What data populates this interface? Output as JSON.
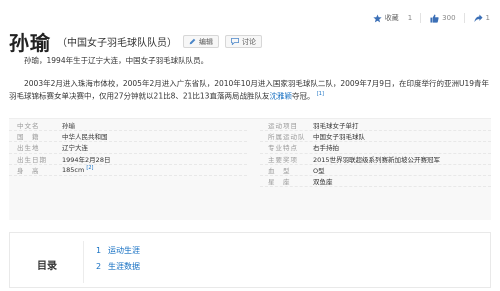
{
  "actions": {
    "favorite_label": "收藏",
    "favorite_count": "1",
    "like_count": "300",
    "share_count": "1"
  },
  "title": {
    "name": "孙瑜",
    "subtitle": "（中国女子羽毛球队队员）",
    "edit_label": "编辑",
    "discuss_label": "讨论"
  },
  "intro": {
    "p1": "孙瑜，1994年生于辽宁大连，中国女子羽毛球队队员。",
    "p2_before": "2003年2月进入珠海市体校，2005年2月进入广东省队，2010年10月进入国家羽毛球队二队，2009年7月9日，在印度举行的亚洲U19青年羽毛球锦标赛女单决赛中，仅用27分钟就以21比8、21比13直落两局战胜队友",
    "p2_link": "沈雅颖",
    "p2_after": "夺冠。",
    "p2_ref": "[1]"
  },
  "info": {
    "left": [
      {
        "k": "中文名",
        "v": "孙瑜",
        "ref": ""
      },
      {
        "k": "国　籍",
        "v": "中华人民共和国",
        "ref": ""
      },
      {
        "k": "出生地",
        "v": "辽宁大连",
        "ref": ""
      },
      {
        "k": "出生日期",
        "v": "1994年2月28日",
        "ref": ""
      },
      {
        "k": "身　高",
        "v": "185cm",
        "ref": "[2]"
      }
    ],
    "right": [
      {
        "k": "运动项目",
        "v": "羽毛球女子单打"
      },
      {
        "k": "所属运动队",
        "v": "中国女子羽毛球队"
      },
      {
        "k": "专业特点",
        "v": "右手持拍"
      },
      {
        "k": "主要奖项",
        "v": "2015世界羽联超级系列赛新加坡公开赛冠军"
      },
      {
        "k": "血　型",
        "v": "O型"
      },
      {
        "k": "星　座",
        "v": "双鱼座"
      }
    ]
  },
  "toc": {
    "title": "目录",
    "items": [
      {
        "n": "1",
        "t": "运动生涯"
      },
      {
        "n": "2",
        "t": "生涯数据"
      }
    ]
  },
  "colors": {
    "link": "#136ec2",
    "star": "#3b6fb6",
    "like": "#e4393c"
  }
}
